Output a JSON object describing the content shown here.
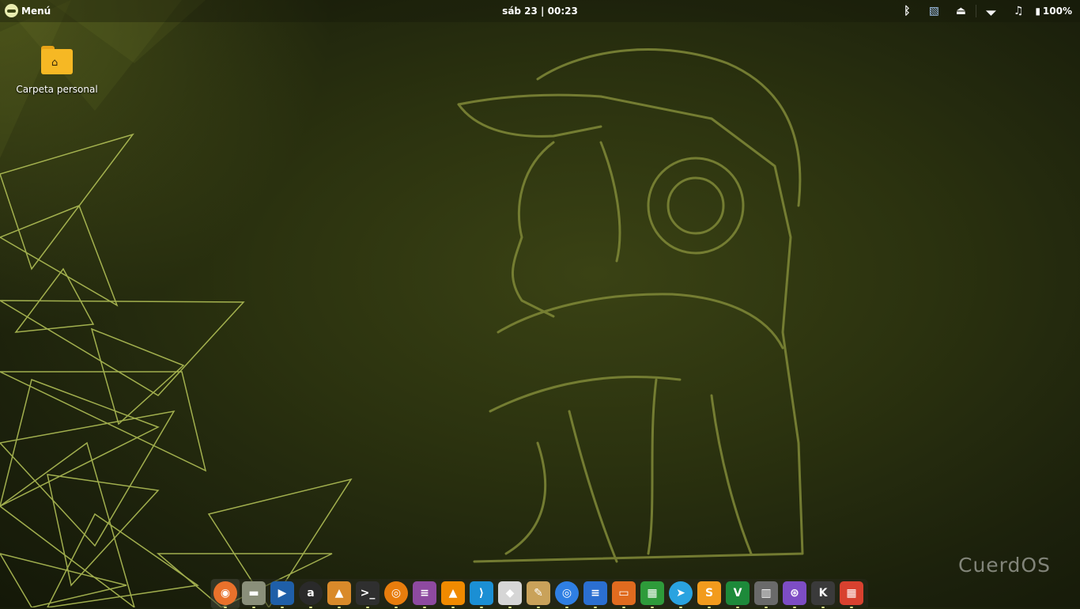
{
  "panel": {
    "menu_label": "Menú",
    "clock": "sáb 23 | 00:23",
    "tray": [
      {
        "icon": "bluetooth-icon",
        "glyph": "ᛒ"
      },
      {
        "icon": "screenshot-tool-icon",
        "glyph": "▧"
      },
      {
        "icon": "eject-drive-icon",
        "glyph": "⏏"
      },
      {
        "icon": "wifi-icon",
        "glyph": "◥"
      },
      {
        "icon": "music-note-icon",
        "glyph": "♫"
      }
    ],
    "battery": {
      "icon": "battery-icon",
      "glyph": "▮",
      "level": "100%"
    }
  },
  "desktop": {
    "icons": [
      {
        "label": "Carpeta personal",
        "icon": "home-folder-icon"
      }
    ],
    "watermark": "CuerdOS"
  },
  "dock": {
    "items": [
      {
        "name": "firefox",
        "glyph": "◉",
        "bg": "#e8651a",
        "round": true,
        "active": true
      },
      {
        "name": "file-manager",
        "glyph": "▬",
        "bg": "#8a8f7a",
        "round": false
      },
      {
        "name": "media-player",
        "glyph": "▶",
        "bg": "#1f5fa8",
        "round": false
      },
      {
        "name": "amazon",
        "glyph": "a",
        "bg": "#2a2a2a",
        "round": true
      },
      {
        "name": "image-viewer",
        "glyph": "▲",
        "bg": "#d98a2a",
        "round": false
      },
      {
        "name": "terminal",
        "glyph": ">_",
        "bg": "#2f2f2f",
        "round": false
      },
      {
        "name": "blender",
        "glyph": "◎",
        "bg": "#e87d0d",
        "round": true
      },
      {
        "name": "tasks-app",
        "glyph": "≡",
        "bg": "#8e4aa0",
        "round": false
      },
      {
        "name": "vlc",
        "glyph": "▲",
        "bg": "#f08a00",
        "round": false
      },
      {
        "name": "vscode",
        "glyph": "⟩",
        "bg": "#1b8fd4",
        "round": false
      },
      {
        "name": "software-store",
        "glyph": "◆",
        "bg": "#d6d6d6",
        "round": false
      },
      {
        "name": "cleaner",
        "glyph": "✎",
        "bg": "#c9a25a",
        "round": false
      },
      {
        "name": "chromium",
        "glyph": "◎",
        "bg": "#2f7fe3",
        "round": true
      },
      {
        "name": "text-document",
        "glyph": "≡",
        "bg": "#2b6fd1",
        "round": false
      },
      {
        "name": "presentation",
        "glyph": "▭",
        "bg": "#e06b1f",
        "round": false
      },
      {
        "name": "spreadsheet",
        "glyph": "▦",
        "bg": "#2e9b3a",
        "round": false
      },
      {
        "name": "telegram",
        "glyph": "➤",
        "bg": "#2aa3e0",
        "round": true
      },
      {
        "name": "sublime-text",
        "glyph": "S",
        "bg": "#f29b1d",
        "round": false
      },
      {
        "name": "vim",
        "glyph": "V",
        "bg": "#1d8a3a",
        "round": false
      },
      {
        "name": "trash",
        "glyph": "▥",
        "bg": "#6a6a6a",
        "round": false
      },
      {
        "name": "system-monitor",
        "glyph": "⊛",
        "bg": "#7d4dc4",
        "round": false
      },
      {
        "name": "kde-app",
        "glyph": "K",
        "bg": "#3a3a3a",
        "round": false
      },
      {
        "name": "firewall",
        "glyph": "▦",
        "bg": "#d8412f",
        "round": false
      }
    ]
  }
}
